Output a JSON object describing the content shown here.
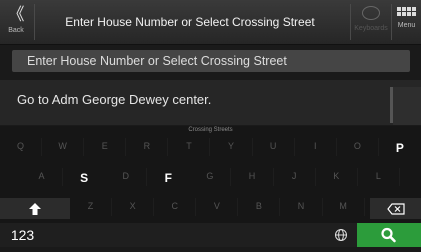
{
  "header": {
    "back_icon": "chevron-double-left-icon",
    "back_label": "Back",
    "title": "Enter House Number or Select Crossing Street",
    "keyboard_icon": "speech-bubble-icon",
    "keyboard_label": "Keyboards",
    "menu_icon": "grid-icon",
    "menu_label": "Menu"
  },
  "search": {
    "placeholder": "Enter House Number or Select Crossing Street",
    "value": ""
  },
  "results": {
    "items": [
      {
        "label": "Go to Adm George Dewey center."
      }
    ]
  },
  "keyboard": {
    "title": "Crossing Streets",
    "row1": [
      "Q",
      "W",
      "E",
      "R",
      "T",
      "Y",
      "U",
      "I",
      "O",
      "P"
    ],
    "row2": [
      "A",
      "S",
      "D",
      "F",
      "G",
      "H",
      "J",
      "K",
      "L"
    ],
    "row3": [
      "Z",
      "X",
      "C",
      "V",
      "B",
      "N",
      "M"
    ],
    "enabled_keys": [
      "P",
      "S",
      "F"
    ],
    "shift_icon": "shift-arrow-icon",
    "backspace_icon": "backspace-icon",
    "numbers_label": "123",
    "globe_icon": "globe-icon",
    "search_icon": "search-icon",
    "accent_color": "#2c9c3b"
  }
}
